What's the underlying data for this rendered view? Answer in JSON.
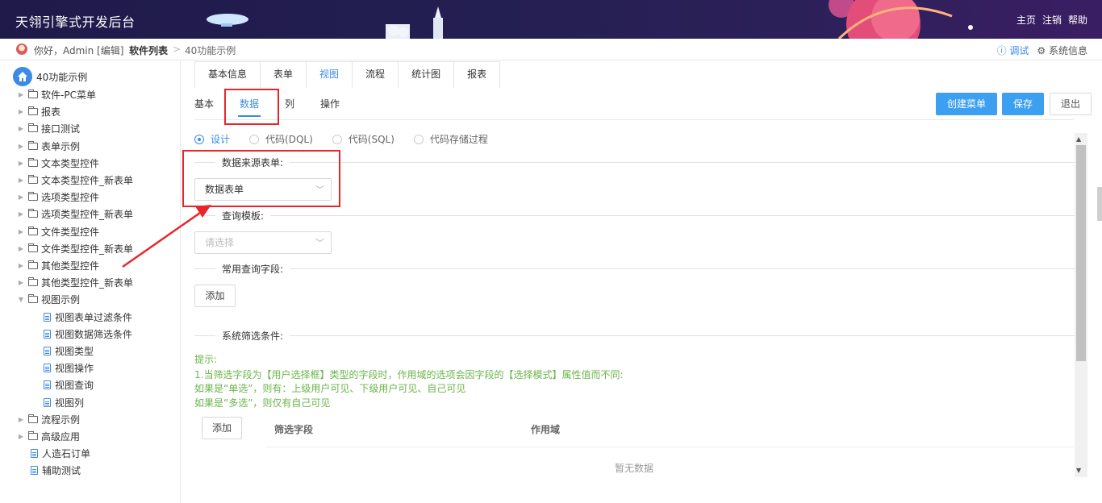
{
  "header": {
    "app_title": "天翎引擎式开发后台",
    "links": [
      "主页",
      "注销",
      "帮助"
    ]
  },
  "crumbs": {
    "greeting": "你好，Admin [编辑]",
    "section": "软件列表",
    "separator": ">",
    "current": "40功能示例",
    "debug": "ⓘ 调试",
    "sysinfo": "⚙ 系统信息"
  },
  "sidebar": {
    "root": "40功能示例",
    "folders": [
      "软件-PC菜单",
      "报表",
      "接口测试",
      "表单示例",
      "文本类型控件",
      "文本类型控件_新表单",
      "选项类型控件",
      "选项类型控件_新表单",
      "文件类型控件",
      "文件类型控件_新表单",
      "其他类型控件",
      "其他类型控件_新表单",
      "视图示例"
    ],
    "view_children": [
      "视图表单过滤条件",
      "视图数据筛选条件",
      "视图类型",
      "视图操作",
      "视图查询",
      "视图列"
    ],
    "folders2": [
      "流程示例",
      "高级应用"
    ],
    "docs": [
      "人造石订单",
      "辅助测试"
    ]
  },
  "tabs": [
    "基本信息",
    "表单",
    "视图",
    "流程",
    "统计图",
    "报表"
  ],
  "active_tab": "视图",
  "subtabs": [
    "基本",
    "数据",
    "列",
    "操作"
  ],
  "active_subtab": "数据",
  "buttons": {
    "create_menu": "创建菜单",
    "save": "保存",
    "exit": "退出"
  },
  "radios": [
    "设计",
    "代码(DQL)",
    "代码(SQL)",
    "代码存储过程"
  ],
  "selected_radio": "设计",
  "sections": {
    "data_source": "数据来源表单:",
    "query_template": "查询模板:",
    "common_fields": "常用查询字段:",
    "system_filter": "系统筛选条件:"
  },
  "data_source_value": "数据表单",
  "query_template_placeholder": "请选择",
  "add_label": "添加",
  "hint_lines": [
    "提示:",
    "1.当筛选字段为【用户选择框】类型的字段时，作用域的选项会因字段的【选择模式】属性值而不同:",
    "如果是“单选”，则有：上级用户可见、下级用户可见、自己可见",
    "如果是“多选”，则仅有自己可见"
  ],
  "table": {
    "col1": "筛选字段",
    "col2": "作用域",
    "empty": "暂无数据"
  },
  "colors": {
    "accent": "#3c8ae6",
    "primary_button": "#3c9ff0",
    "hint": "#6ab549",
    "annotation": "#e8262a",
    "header_bg": "#1f1a4a"
  }
}
